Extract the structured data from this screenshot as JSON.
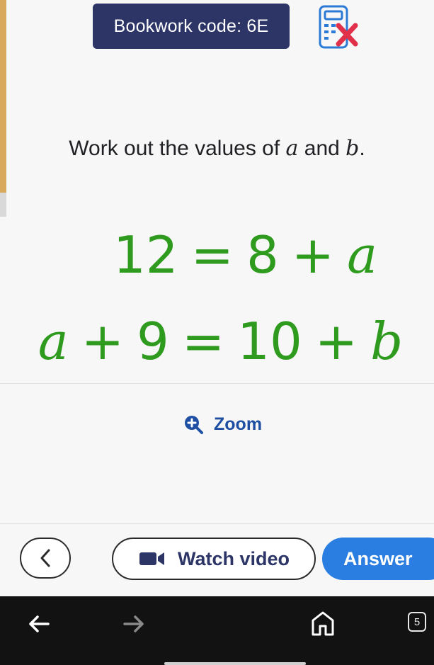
{
  "header": {
    "bookwork_label": "Bookwork code: 6E",
    "calculator_status_icon": "calculator-not-allowed-icon"
  },
  "question": {
    "prefix": "Work out the values of ",
    "var_a": "a",
    "connector": " and ",
    "var_b": "b",
    "suffix": "."
  },
  "equations": {
    "line1": {
      "lhs": "12",
      "eq": "=",
      "term1": "8",
      "plus": "+",
      "var": "a"
    },
    "line2": {
      "var": "a",
      "plus1": "+",
      "term1": "9",
      "eq": "=",
      "term2": "10",
      "plus2": "+",
      "var2": "b"
    }
  },
  "zoom": {
    "label": "Zoom"
  },
  "actions": {
    "watch_video_label": "Watch video",
    "answer_label": "Answer"
  },
  "browser_nav": {
    "tab_count": "5"
  },
  "colors": {
    "equation_green": "#2e9b1e",
    "bookwork_navy": "#2c3566",
    "answer_blue": "#2a7de1",
    "zoom_blue": "#1f4fa3"
  }
}
